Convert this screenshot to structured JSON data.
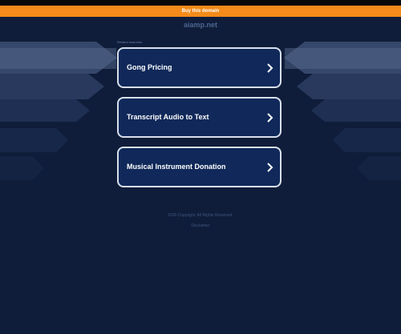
{
  "banner": {
    "buy_label": "Buy this domain"
  },
  "header": {
    "domain": "aiamp.net",
    "related_label": "Related searches"
  },
  "searches": [
    {
      "label": "Gong Pricing"
    },
    {
      "label": "Transcript Audio to Text"
    },
    {
      "label": "Musical Instrument Donation"
    }
  ],
  "footer": {
    "line1": "2025 Copyright. All Rights Reserved.",
    "line2": "Disclaimer"
  },
  "colors": {
    "background": "#0f1d3a",
    "banner": "#f48b1a",
    "card": "#10295a",
    "card_border": "#d8dfeb"
  },
  "icons": {
    "chevron": "chevron-right-icon"
  }
}
